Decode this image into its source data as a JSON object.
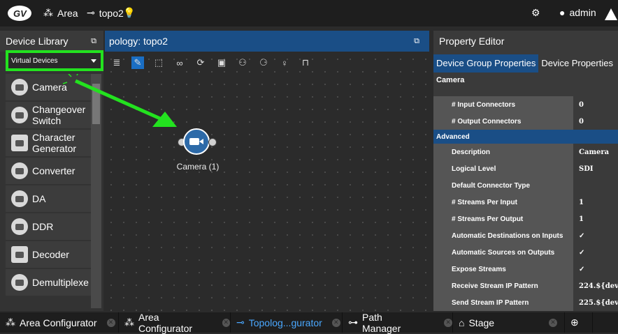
{
  "topbar": {
    "area_label": "Area",
    "topology_label": "topo2",
    "user_label": "admin"
  },
  "library": {
    "title": "Device Library",
    "dropdown_value": "Virtual Devices",
    "items": [
      {
        "label": "Camera",
        "icon": "camera-icon"
      },
      {
        "label": "Changeover Switch",
        "icon": "changeover-icon"
      },
      {
        "label": "Character Generator",
        "icon": "cg-icon"
      },
      {
        "label": "Converter",
        "icon": "converter-icon"
      },
      {
        "label": "DA",
        "icon": "da-icon"
      },
      {
        "label": "DDR",
        "icon": "ddr-icon"
      },
      {
        "label": "Decoder",
        "icon": "decoder-icon"
      },
      {
        "label": "Demultiplexe",
        "icon": "demux-icon"
      }
    ]
  },
  "topology": {
    "title": "pology: topo2",
    "node_label": "Camera (1)"
  },
  "property_editor": {
    "title": "Property Editor",
    "tabs": [
      "Device Group Properties",
      "Device Properties"
    ],
    "group_title": "Camera",
    "rows_top": [
      {
        "key": "# Input Connectors",
        "value": "0"
      },
      {
        "key": "# Output Connectors",
        "value": "0"
      }
    ],
    "section": "Advanced",
    "rows_adv": [
      {
        "key": "Description",
        "value": "Camera"
      },
      {
        "key": "Logical Level",
        "value": "SDI"
      },
      {
        "key": "Default Connector Type",
        "value": ""
      },
      {
        "key": "# Streams Per Input",
        "value": "1"
      },
      {
        "key": "# Streams Per Output",
        "value": "1"
      },
      {
        "key": "Automatic Destinations on Inputs",
        "value": "✓"
      },
      {
        "key": "Automatic Sources on Outputs",
        "value": "✓"
      },
      {
        "key": "Expose Streams",
        "value": "✓"
      },
      {
        "key": "Receive Stream IP Pattern",
        "value": "224.${dev"
      },
      {
        "key": "Send Stream IP Pattern",
        "value": "225.${dev"
      }
    ]
  },
  "bottom_tabs": [
    {
      "label": "Area Configurator"
    },
    {
      "label": "Area Configurator"
    },
    {
      "label": "Topolog...gurator"
    },
    {
      "label": "Path Manager"
    },
    {
      "label": "Stage"
    }
  ],
  "colors": {
    "accent_blue": "#1a4e86",
    "highlight_green": "#23e21f"
  }
}
